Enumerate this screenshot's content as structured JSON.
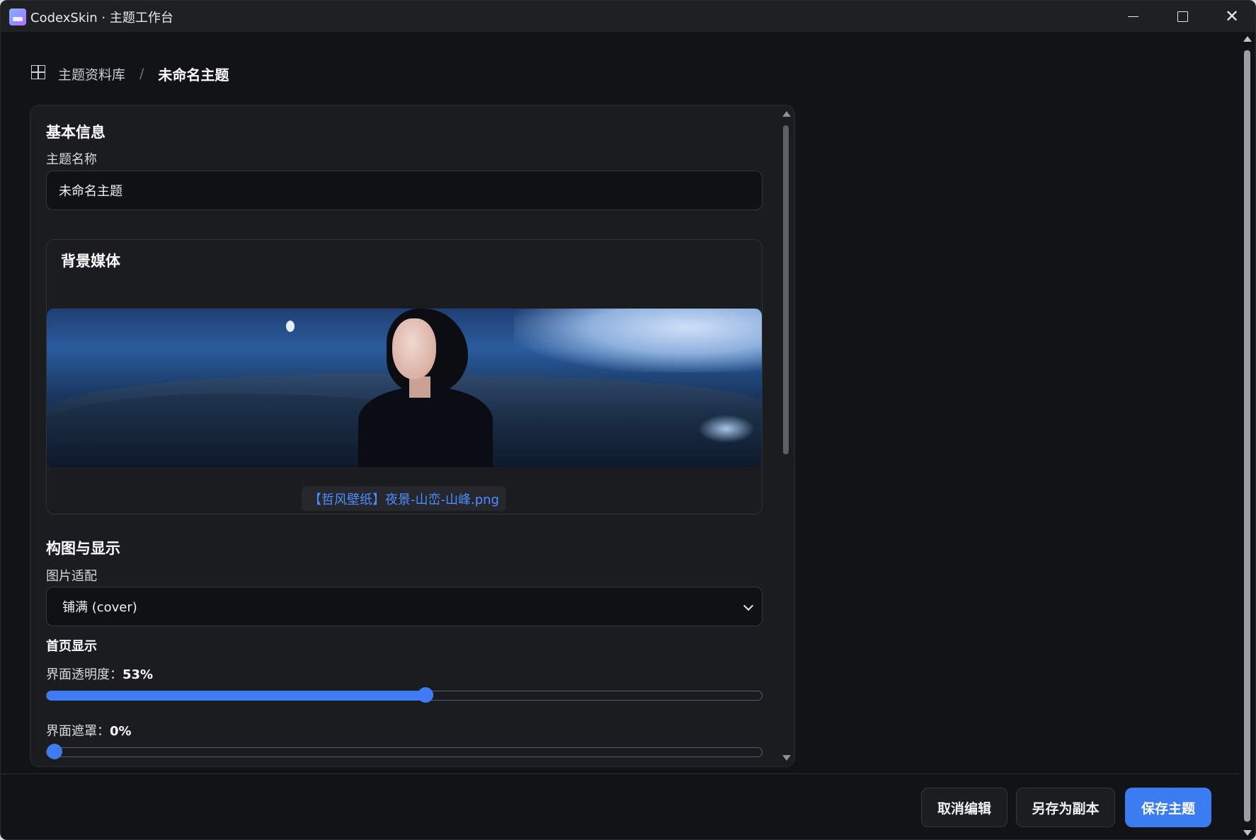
{
  "window": {
    "title": "CodexSkin · 主题工作台",
    "icons": {
      "app": "app-logo-icon",
      "minimize": "minimize-icon",
      "maximize": "maximize-icon",
      "close": "close-icon"
    },
    "close_glyph": "✕"
  },
  "breadcrumb": {
    "icon": "grid-icon",
    "root": "主题资料库",
    "separator": "/",
    "current": "未命名主题"
  },
  "basic_info": {
    "title": "基本信息",
    "name_label": "主题名称",
    "name_value": "未命名主题"
  },
  "background_media": {
    "title": "背景媒体",
    "file_name": "【哲风壁纸】夜景-山峦-山峰.png"
  },
  "composition": {
    "title": "构图与显示",
    "fit_label": "图片适配",
    "fit_value": "铺满 (cover)",
    "homepage_title": "首页显示",
    "opacity_label": "界面透明度：",
    "opacity_value": "53%",
    "opacity_percent": 53,
    "mask_label": "界面遮罩：",
    "mask_value": "0%",
    "mask_percent": 0
  },
  "footer": {
    "cancel": "取消编辑",
    "save_copy": "另存为副本",
    "save": "保存主题"
  },
  "colors": {
    "accent": "#3b7cf2",
    "link": "#4c8dff",
    "background": "#121316",
    "panel": "#1b1c1f"
  }
}
